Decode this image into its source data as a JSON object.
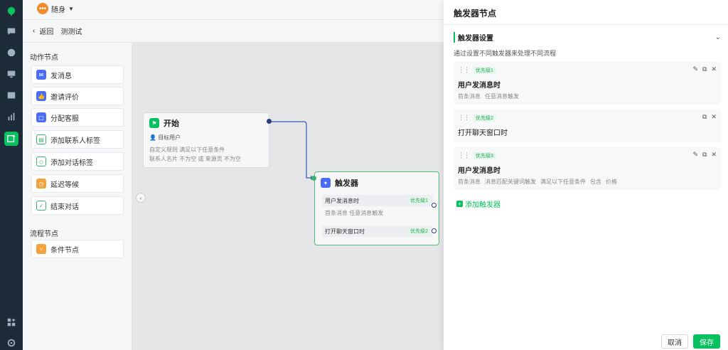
{
  "brand": {
    "name": "随身"
  },
  "breadcrumb": {
    "back": "返回",
    "title": "测测试"
  },
  "palette": {
    "action_section": "动作节点",
    "actions": [
      "发消息",
      "邀请评价",
      "分配客服",
      "添加联系人标签",
      "添加对话标签",
      "延迟等候",
      "结束对话"
    ],
    "flow_section": "流程节点",
    "flows": [
      "条件节点"
    ]
  },
  "start_node": {
    "title": "开始",
    "target": "目标用户",
    "rule": "自定义规则 满足以下任意条件",
    "cond": "联系人名片   不为空   或   来源页   不为空"
  },
  "trigger_node": {
    "title": "触发器",
    "row1": "用户发消息时",
    "row1_pri": "优先级1",
    "row1_sub": "首条消息  任意消息触发",
    "row2": "打开聊天窗口时",
    "row2_pri": "优先级2"
  },
  "panel": {
    "title": "触发器节点",
    "section": "触发器设置",
    "desc": "通过设置不同触发器来处理不同流程",
    "cards": [
      {
        "pri": "优先级1",
        "title": "用户发消息时",
        "tags": [
          "首条消息",
          "任意消息触发"
        ]
      },
      {
        "pri": "优先级2",
        "title": "打开聊天窗口时",
        "tags": []
      },
      {
        "pri": "优先级3",
        "title": "用户发消息时",
        "tags": [
          "首条消息",
          "消息匹配关键词触发",
          "满足以下任意条件",
          "包含",
          "价格"
        ]
      }
    ],
    "add_trigger": "添加触发器",
    "cancel": "取消",
    "save": "保存"
  }
}
